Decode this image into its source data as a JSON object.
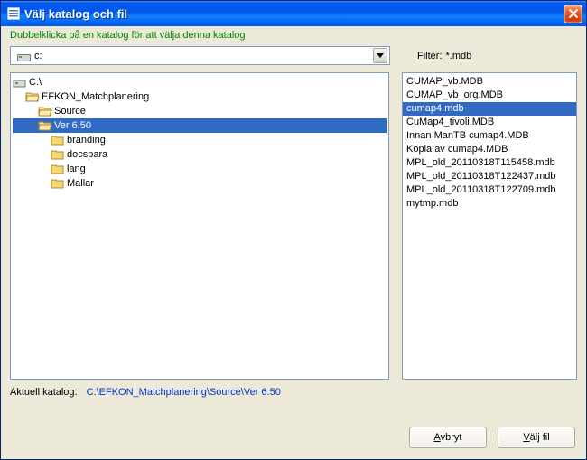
{
  "title": "Välj katalog och fil",
  "hint": "Dubbelklicka på en katalog för att välja denna katalog",
  "drive": {
    "label": "c:"
  },
  "filter": {
    "label": "Filter:",
    "value": "*.mdb"
  },
  "tree": [
    {
      "label": "C:\\",
      "depth": 0,
      "open": true,
      "selected": false,
      "root": true
    },
    {
      "label": "EFKON_Matchplanering",
      "depth": 1,
      "open": true,
      "selected": false
    },
    {
      "label": "Source",
      "depth": 2,
      "open": true,
      "selected": false
    },
    {
      "label": "Ver 6.50",
      "depth": 2,
      "open": true,
      "selected": true
    },
    {
      "label": "branding",
      "depth": 3,
      "open": false,
      "selected": false
    },
    {
      "label": "docspara",
      "depth": 3,
      "open": false,
      "selected": false
    },
    {
      "label": "lang",
      "depth": 3,
      "open": false,
      "selected": false
    },
    {
      "label": "Mallar",
      "depth": 3,
      "open": false,
      "selected": false
    }
  ],
  "files": [
    {
      "name": "CUMAP_vb.MDB",
      "selected": false
    },
    {
      "name": "CUMAP_vb_org.MDB",
      "selected": false
    },
    {
      "name": "cumap4.mdb",
      "selected": true
    },
    {
      "name": "CuMap4_tivoli.MDB",
      "selected": false
    },
    {
      "name": "Innan ManTB cumap4.MDB",
      "selected": false
    },
    {
      "name": "Kopia av cumap4.MDB",
      "selected": false
    },
    {
      "name": "MPL_old_20110318T115458.mdb",
      "selected": false
    },
    {
      "name": "MPL_old_20110318T122437.mdb",
      "selected": false
    },
    {
      "name": "MPL_old_20110318T122709.mdb",
      "selected": false
    },
    {
      "name": "mytmp.mdb",
      "selected": false
    }
  ],
  "currentPath": {
    "label": "Aktuell katalog:",
    "value": "C:\\EFKON_Matchplanering\\Source\\Ver 6.50"
  },
  "buttons": {
    "cancel": {
      "pre": "",
      "m": "A",
      "post": "vbryt"
    },
    "ok": {
      "pre": "",
      "m": "V",
      "post": "älj fil"
    }
  }
}
